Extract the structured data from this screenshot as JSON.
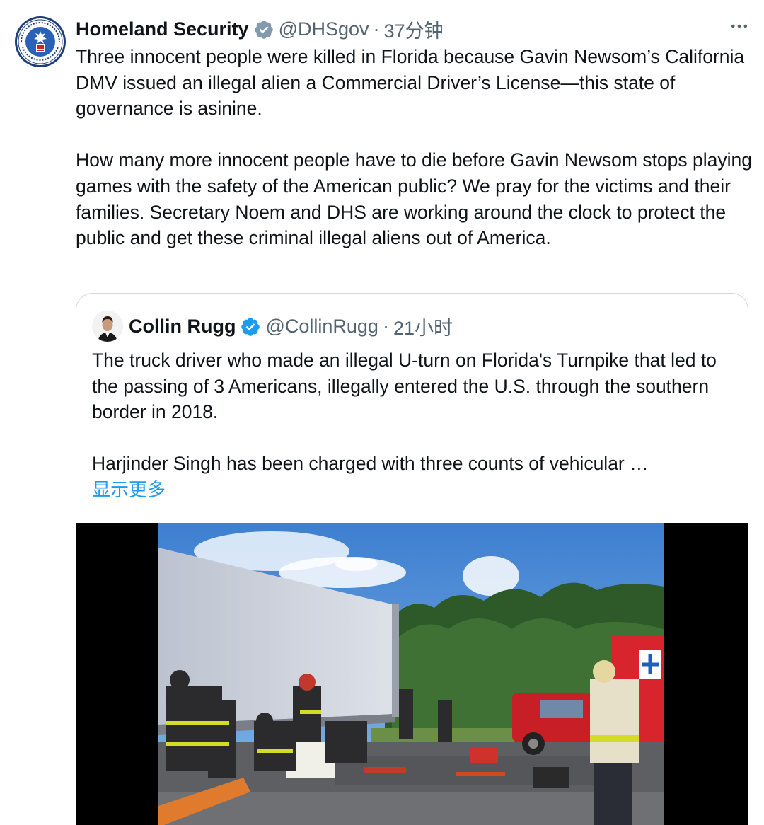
{
  "tweet": {
    "author_name": "Homeland Security",
    "handle": "@DHSgov",
    "separator": "·",
    "time": "37分钟",
    "more_icon": "more-horizontal-icon",
    "verified_color": "#829aab",
    "paragraphs": [
      "Three innocent people were killed in Florida because Gavin Newsom’s California DMV issued an illegal alien a Commercial Driver’s License—this state of governance is asinine.",
      "How many more innocent people have to die before Gavin Newsom stops playing games with the safety of the American public? We pray for the victims and their families. Secretary Noem and DHS are working around the clock to protect the public and get these criminal illegal aliens out of America."
    ]
  },
  "quoted": {
    "author_name": "Collin Rugg",
    "handle": "@CollinRugg",
    "separator": "·",
    "time": "21小时",
    "verified_color": "#1d9bf0",
    "paragraphs": [
      "The truck driver who made an illegal U-turn on Florida's Turnpike that led to the passing of 3 Americans, illegally entered the U.S. through the southern border in 2018.",
      "Harjinder Singh has been charged with three counts of vehicular …"
    ],
    "show_more": "显示更多",
    "link_color": "#1d9bf0"
  }
}
